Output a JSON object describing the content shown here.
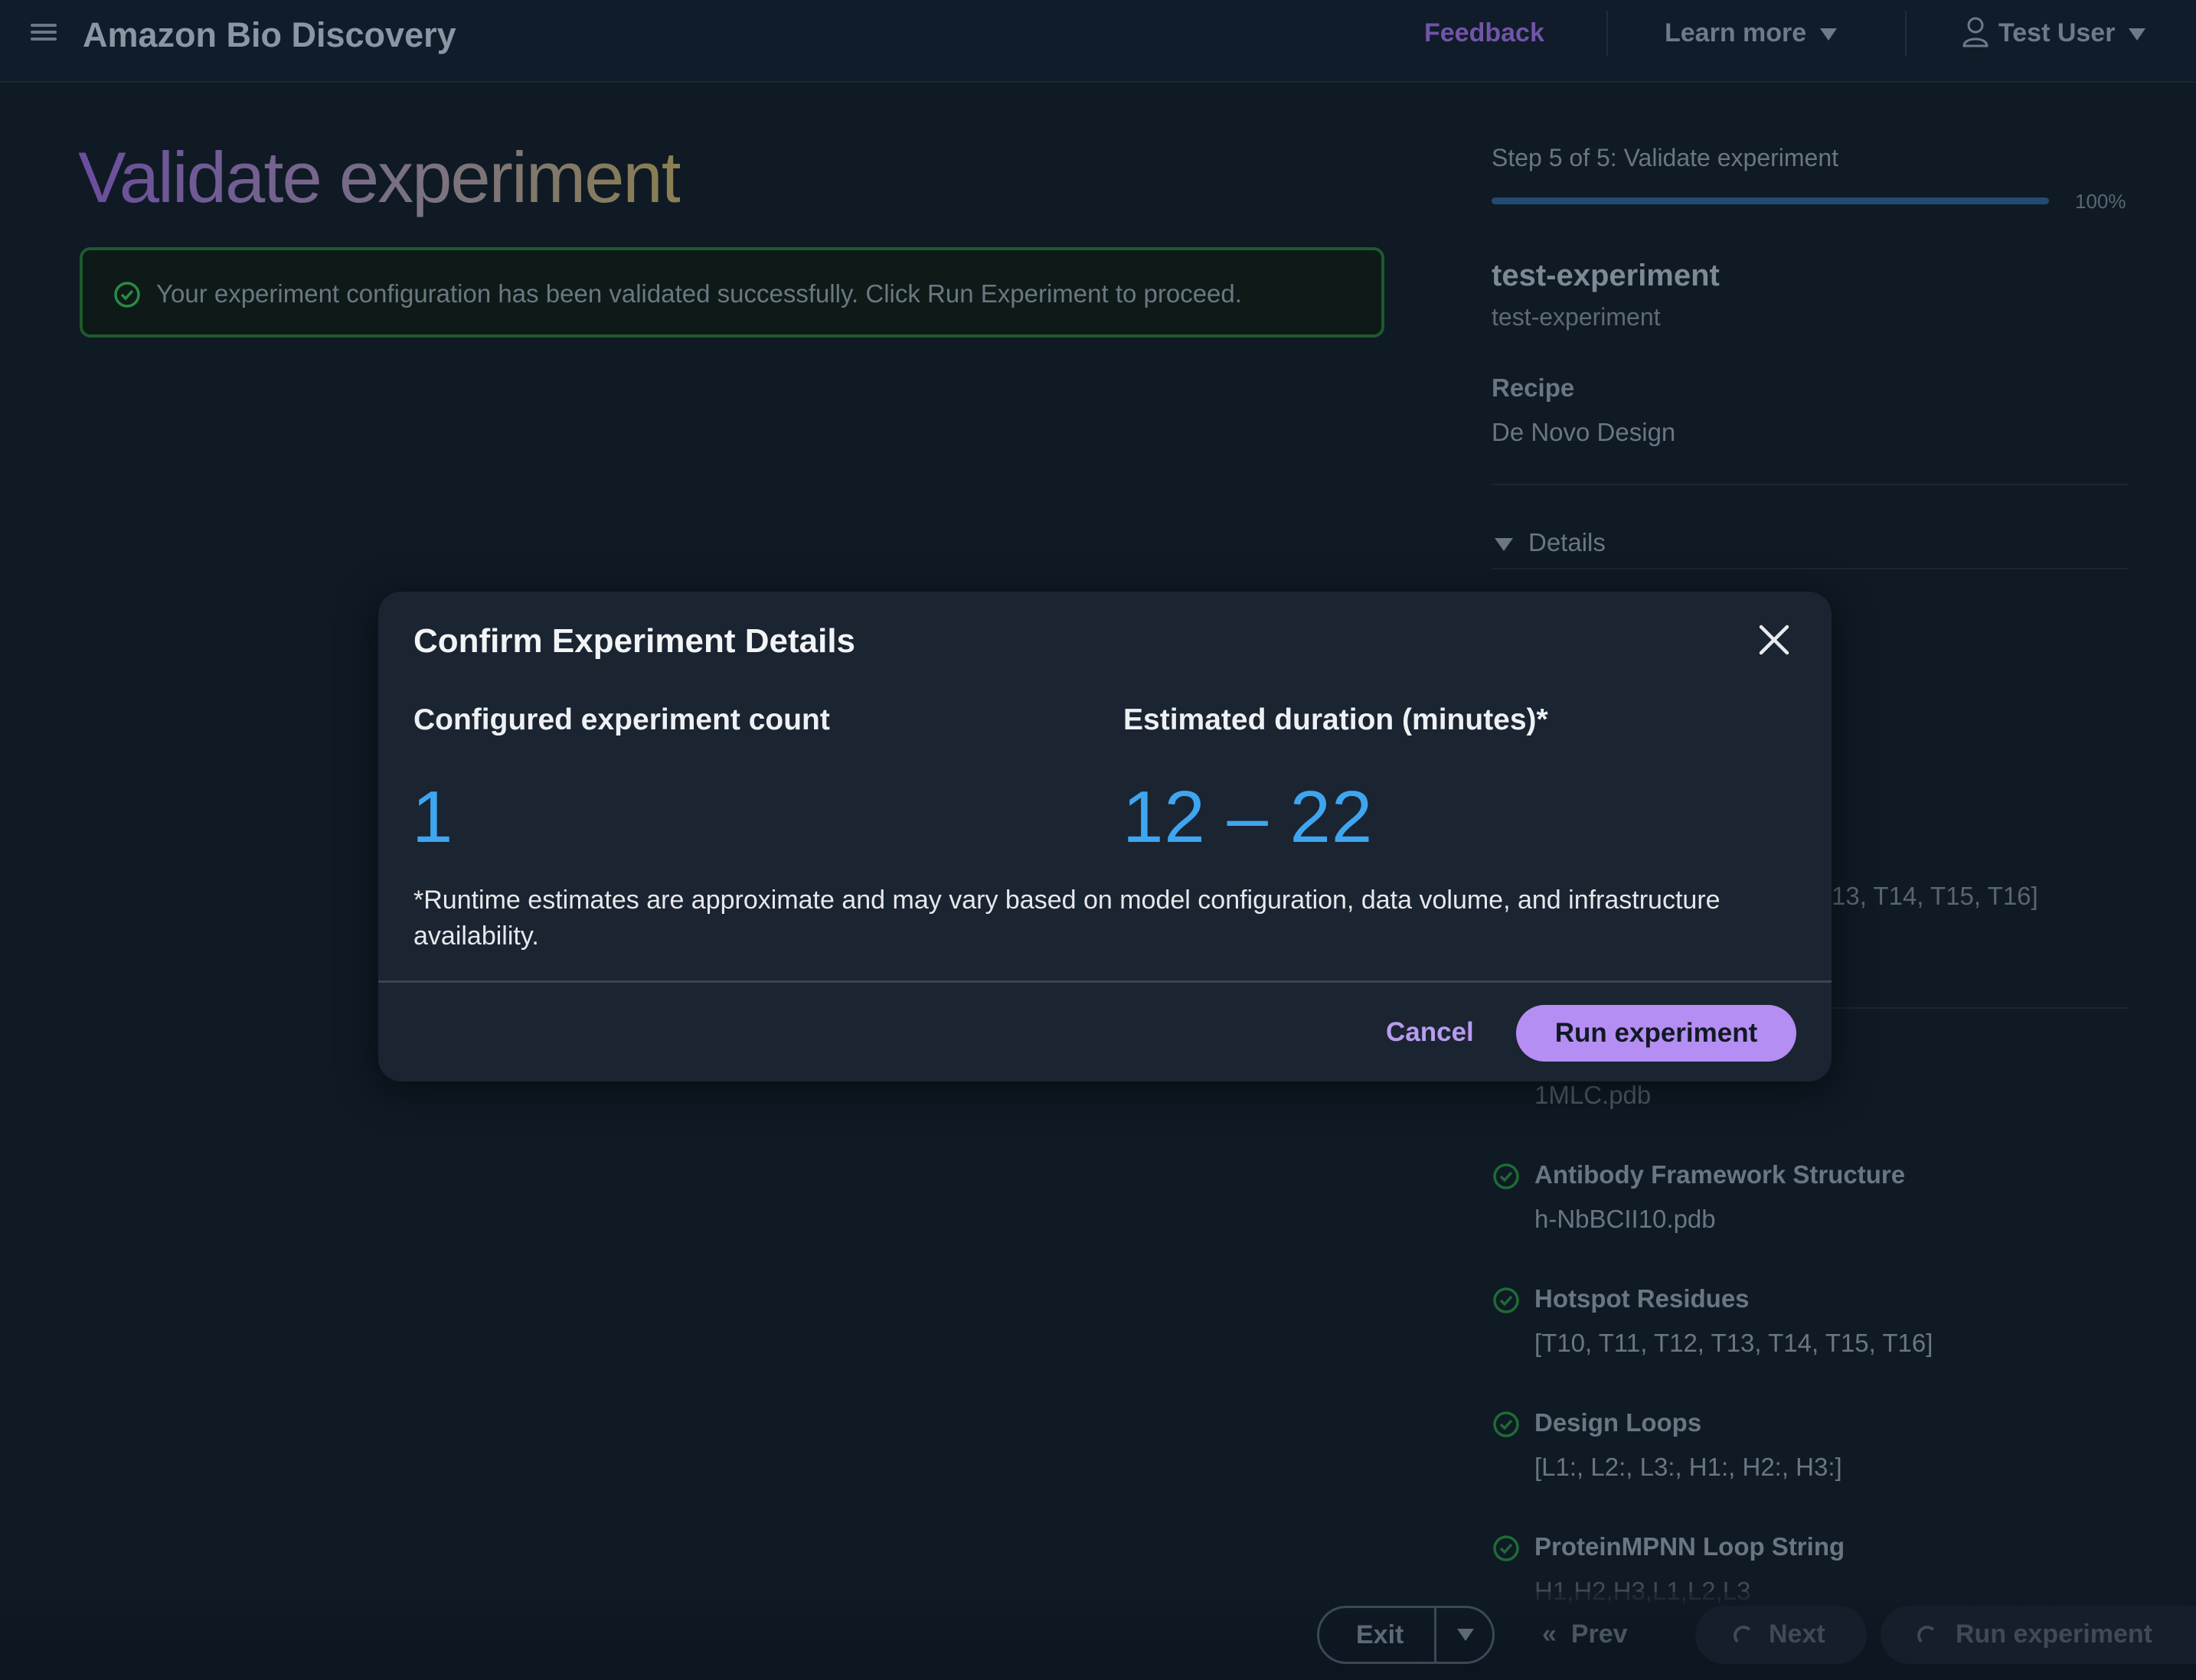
{
  "header": {
    "app_title": "Amazon Bio Discovery",
    "feedback": "Feedback",
    "learn_more": "Learn more",
    "user": "Test User"
  },
  "page": {
    "title": "Validate experiment",
    "alert": "Your experiment configuration has been validated successfully. Click Run Experiment to proceed."
  },
  "summary": {
    "step": "Step 5 of 5: Validate experiment",
    "progress_percent": 100,
    "progress_label": "100%",
    "experiment_name": "test-experiment",
    "experiment_sub": "test-experiment",
    "recipe_label": "Recipe",
    "recipe_value": "De Novo Design",
    "details_label": "Details",
    "partial_hotspot_text": "13, T14, T15, T16]",
    "partial_file_text": "1MLC.pdb",
    "items": [
      {
        "label": "Antibody Framework Structure",
        "value": "h-NbBCII10.pdb"
      },
      {
        "label": "Hotspot Residues",
        "value": "[T10, T11, T12, T13, T14, T15, T16]"
      },
      {
        "label": "Design Loops",
        "value": "[L1:, L2:, L3:, H1:, H2:, H3:]"
      },
      {
        "label": "ProteinMPNN Loop String",
        "value": "H1,H2,H3,L1,L2,L3"
      }
    ]
  },
  "footer": {
    "exit": "Exit",
    "prev": "Prev",
    "next": "Next",
    "run": "Run experiment"
  },
  "modal": {
    "title": "Confirm Experiment Details",
    "count_label": "Configured experiment count",
    "count_value": "1",
    "duration_label": "Estimated duration (minutes)*",
    "duration_value": "12 – 22",
    "note": "*Runtime estimates are approximate and may vary based on model configuration, data volume, and infrastructure availability.",
    "cancel": "Cancel",
    "run": "Run experiment"
  },
  "colors": {
    "accent": "#b48ef2",
    "metric": "#3ea6f0",
    "success": "#1d5a2e"
  }
}
